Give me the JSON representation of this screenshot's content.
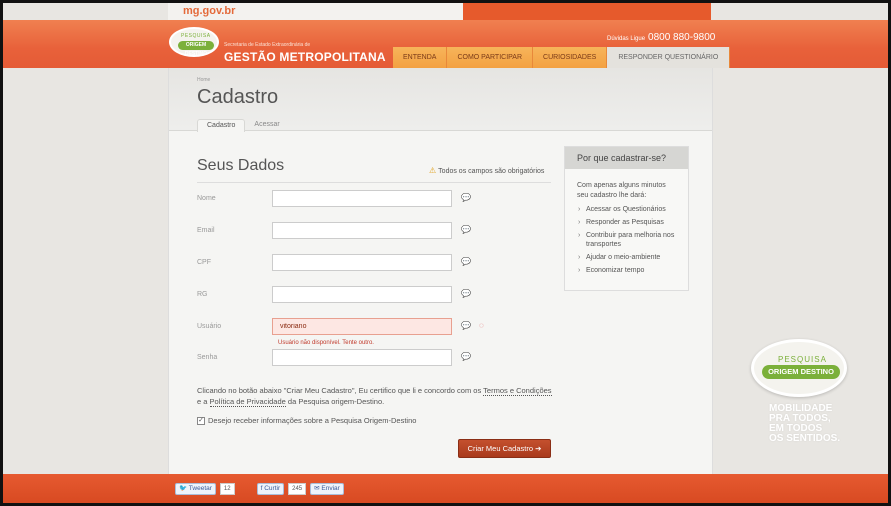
{
  "gov_link": "mg.gov.br",
  "header": {
    "logo_caption": "PESQUISA",
    "logo_pill": "ORIGEM DESTINO",
    "secretaria": "Secretaria de Estado Extraordinária de",
    "brand": "GESTÃO METROPOLITANA",
    "duvidas_label": "Dúvidas Ligue",
    "phone": "0800 880-9800"
  },
  "nav": [
    "ENTENDA",
    "COMO PARTICIPAR",
    "CURIOSIDADES",
    "RESPONDER QUESTIONÁRIO"
  ],
  "page": {
    "breadcrumb": "Home",
    "title": "Cadastro",
    "tabs": [
      "Cadastro",
      "Acessar"
    ]
  },
  "form": {
    "section_title": "Seus Dados",
    "required_note": "Todos os campos são obrigatórios",
    "fields": {
      "nome": {
        "label": "Nome",
        "value": ""
      },
      "email": {
        "label": "Email",
        "value": ""
      },
      "cpf": {
        "label": "CPF",
        "value": ""
      },
      "rg": {
        "label": "RG",
        "value": ""
      },
      "usuario": {
        "label": "Usuário",
        "value": "vitoriano"
      },
      "senha": {
        "label": "Senha",
        "value": ""
      }
    },
    "usuario_error": "Usuário não disponível. Tente outro.",
    "terms_pre": "Clicando no botão abaixo \"Criar Meu Cadastro\", Eu certifico que li e concordo com os ",
    "terms_link": "Termos e Condições",
    "terms_mid": " e a ",
    "privacy_link": "Política de Privacidade",
    "terms_post": " da Pesquisa origem-Destino.",
    "newsletter": "Desejo receber informações sobre a Pesquisa Origem-Destino",
    "newsletter_checked": true,
    "submit": "Criar Meu Cadastro"
  },
  "sidebar": {
    "title": "Por que cadastrar-se?",
    "intro": "Com apenas alguns minutos seu cadastro lhe dará:",
    "items": [
      "Acessar os Questionários",
      "Responder as Pesquisas",
      "Contribuir para melhoria nos transportes",
      "Ajudar o meio-ambiente",
      "Economizar tempo"
    ]
  },
  "social": {
    "tweet": "Tweetar",
    "tweet_count": "12",
    "like": "Curtir",
    "like_count": "245",
    "send": "Enviar"
  },
  "promo": {
    "caption": "PESQUISA",
    "pill": "ORIGEM DESTINO",
    "line1": "MOBILIDADE",
    "line2": "PRA TODOS,",
    "line3": "EM TODOS",
    "line4": "OS SENTIDOS."
  }
}
